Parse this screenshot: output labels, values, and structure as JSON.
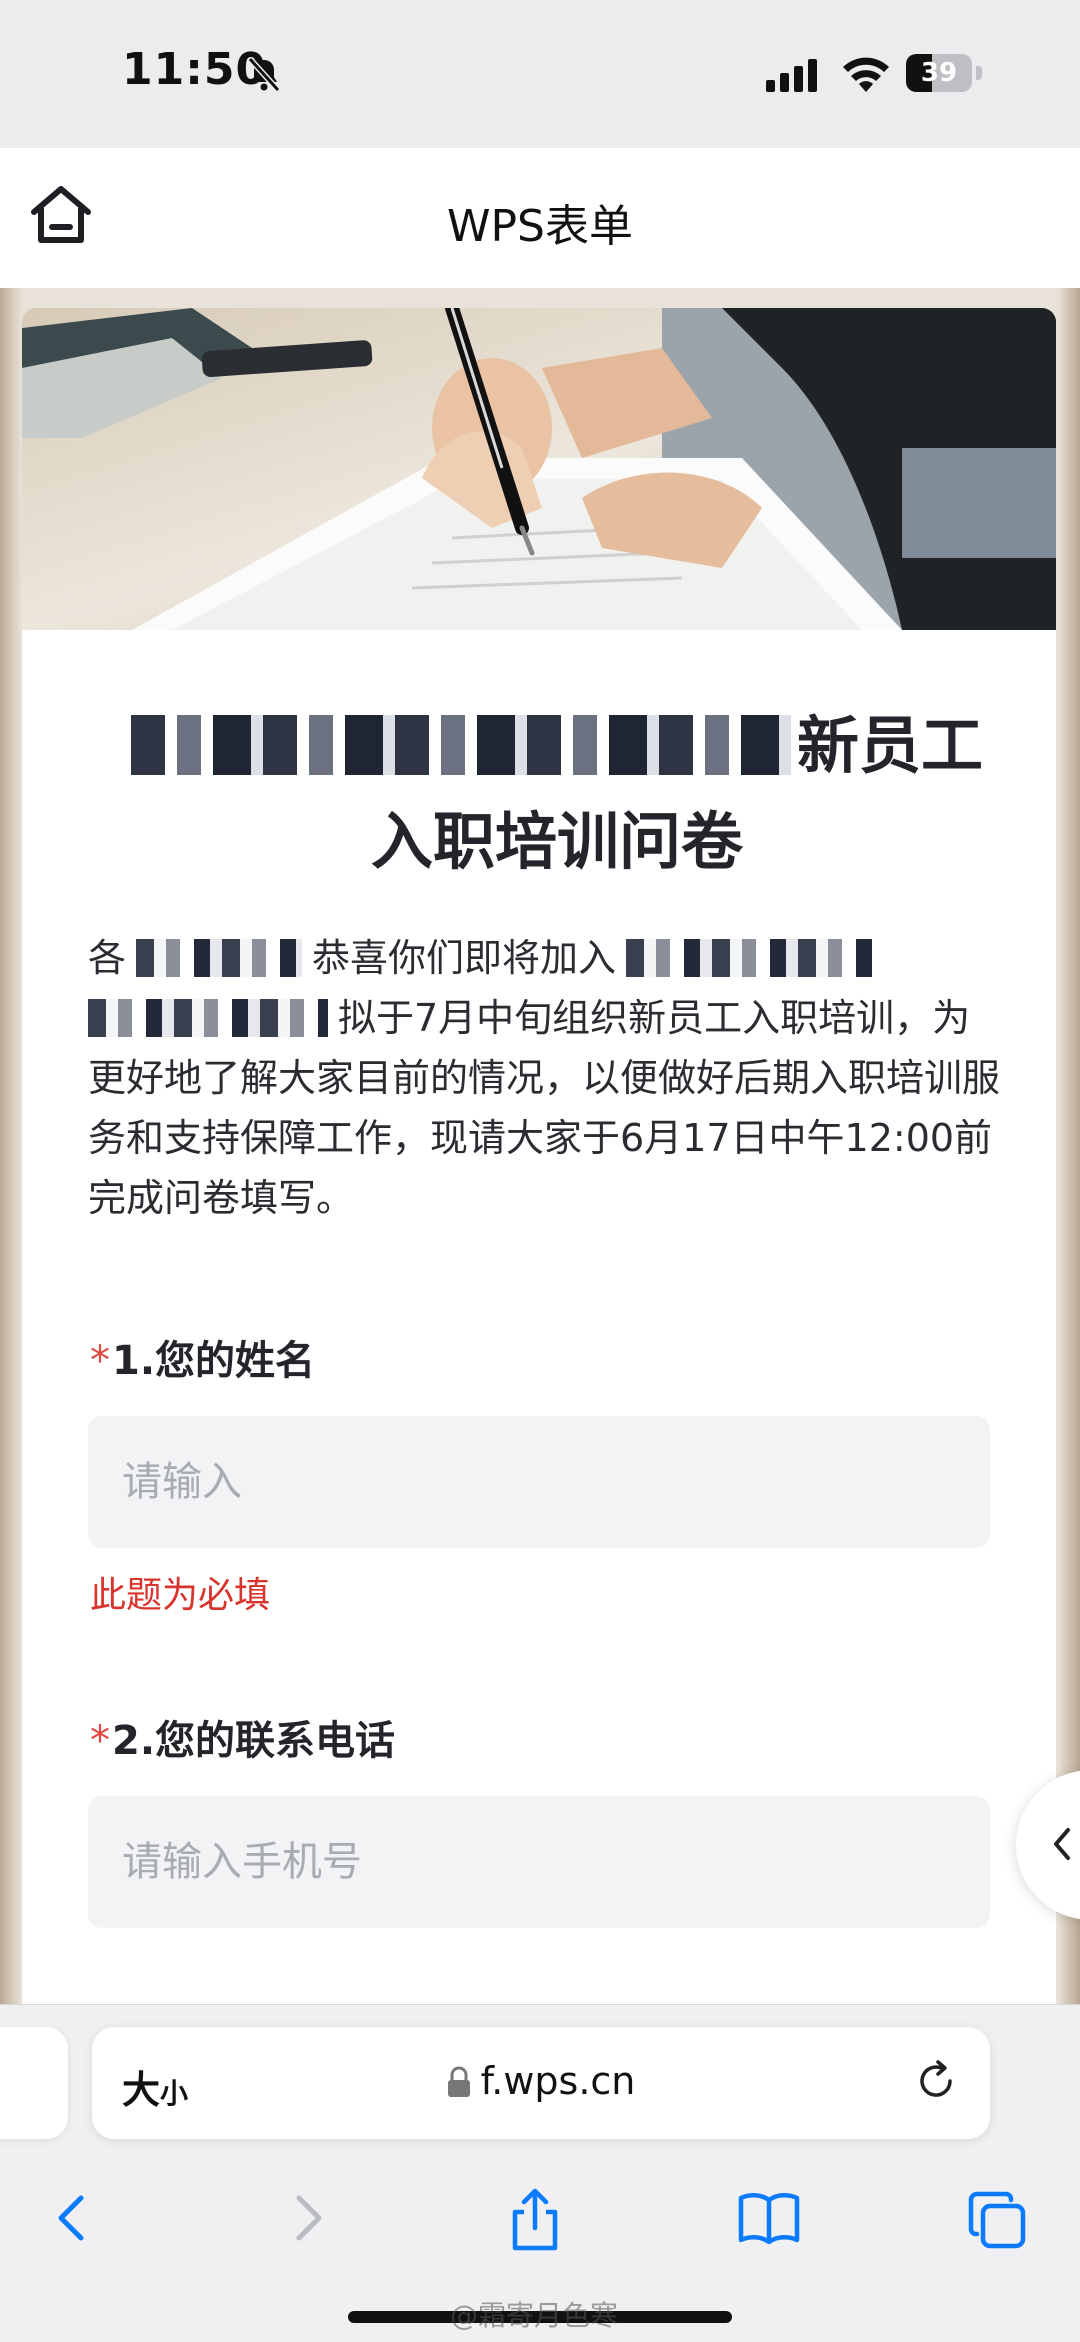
{
  "status_bar": {
    "time": "11:50",
    "battery": "39",
    "battery_level": 0.39,
    "icons": [
      "bell-off-icon",
      "signal-icon",
      "wifi-icon",
      "battery-icon"
    ]
  },
  "header": {
    "title": "WPS表单",
    "home_icon": "home-icon"
  },
  "form": {
    "title_visible": "新员工入职培训问卷",
    "title_line2": "入职培训问卷",
    "title_line1_tail": "新员工",
    "intro": {
      "p1": "各",
      "p2": "恭喜你们即将加入",
      "p3": "拟于7月中旬组织新员工入职培训，为更好地了解大家目前的情况，以便做好后期入职培训服务和支持保障工作，现请大家于6月17日中午12:00前完成问卷填写。"
    },
    "questions": [
      {
        "required_mark": "*",
        "label": "1.您的姓名",
        "placeholder": "请输入",
        "error": "此题为必填"
      },
      {
        "required_mark": "*",
        "label": "2.您的联系电话",
        "placeholder": "请输入手机号"
      }
    ]
  },
  "browser": {
    "text_size_label": "大",
    "text_size_small": "小",
    "url": "f.wps.cn",
    "toolbar": [
      "back-icon",
      "forward-icon",
      "share-icon",
      "bookmarks-icon",
      "tabs-icon"
    ]
  },
  "watermark": "@霜寄月色寒",
  "colors": {
    "required": "#e0463f",
    "error": "#d8342d",
    "ios_blue": "#0a7aff",
    "input_bg": "#f2f3f5"
  }
}
